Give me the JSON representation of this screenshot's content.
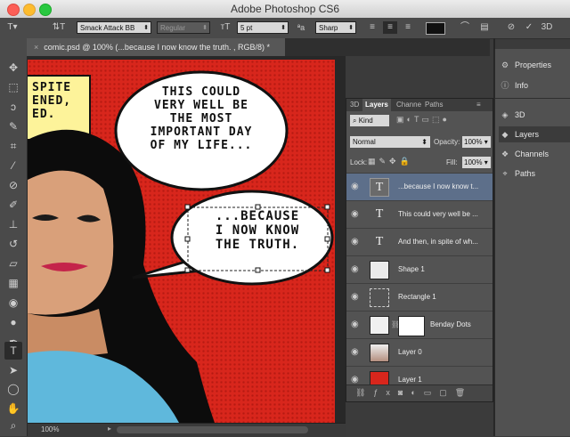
{
  "window": {
    "title": "Adobe Photoshop CS6"
  },
  "options_bar": {
    "font_family": "Smack Attack BB",
    "font_style": "Regular",
    "font_size": "5 pt",
    "antialias": "Sharp"
  },
  "document": {
    "tab_title": "comic.psd @ 100% (...because I now know the truth.    , RGB/8) *",
    "zoom": "100%"
  },
  "canvas": {
    "caption_lines": [
      "SPITE",
      "ENED,",
      "ED."
    ],
    "bubble1_lines": [
      "THIS COULD",
      "VERY WELL BE",
      "THE MOST",
      "IMPORTANT DAY",
      "OF MY LIFE..."
    ],
    "bubble2_lines": [
      "...BECAUSE",
      "I NOW KNOW",
      "THE TRUTH."
    ]
  },
  "layers_panel": {
    "tabs": [
      "3D",
      "Layers",
      "Channe",
      "Paths"
    ],
    "kind_filter": "Kind",
    "blend_mode": "Normal",
    "opacity_label": "Opacity:",
    "opacity": "100%",
    "lock_label": "Lock:",
    "fill_label": "Fill:",
    "fill": "100%",
    "layers": [
      {
        "name": "...because I now know t...",
        "type": "text",
        "selected": true
      },
      {
        "name": "This could very well be ...",
        "type": "text",
        "selected": false
      },
      {
        "name": "And then, in spite of wh...",
        "type": "text",
        "selected": false
      },
      {
        "name": "Shape 1",
        "type": "shape",
        "selected": false
      },
      {
        "name": "Rectangle 1",
        "type": "rect",
        "selected": false
      },
      {
        "name": "Benday Dots",
        "type": "adjust",
        "selected": false
      },
      {
        "name": "Layer 0",
        "type": "photo",
        "selected": false
      },
      {
        "name": "Layer 1",
        "type": "red",
        "selected": false
      }
    ]
  },
  "dock": {
    "items": [
      "Properties",
      "Info",
      "3D",
      "Layers",
      "Channels",
      "Paths"
    ],
    "active": "Layers"
  },
  "colors": {
    "selected_layer": "#5d6f8a",
    "canvas_red": "#d8261c",
    "caption_yellow": "#fdf39a"
  }
}
